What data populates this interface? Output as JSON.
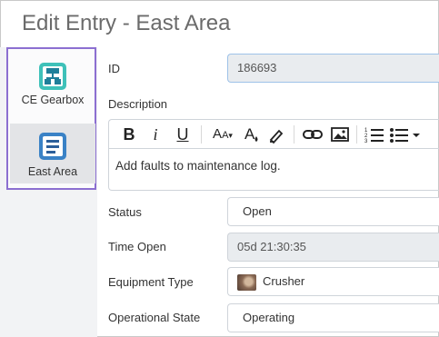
{
  "header": {
    "title": "Edit Entry - East Area"
  },
  "sidebar": {
    "items": [
      {
        "label": "CE Gearbox",
        "icon": "gearbox-hierarchy-icon",
        "active": false
      },
      {
        "label": "East Area",
        "icon": "area-document-icon",
        "active": true
      }
    ],
    "highlight_color": "#8c6fd1"
  },
  "form": {
    "id": {
      "label": "ID",
      "value": "186693"
    },
    "description": {
      "label": "Description",
      "content": "Add faults to maintenance log.",
      "toolbar": [
        "bold-icon",
        "italic-icon",
        "underline-icon",
        "font-size-icon",
        "text-color-icon",
        "highlight-icon",
        "link-icon",
        "image-icon",
        "ordered-list-icon",
        "unordered-list-icon"
      ]
    },
    "status": {
      "label": "Status",
      "value": "Open"
    },
    "time_open": {
      "label": "Time Open",
      "value": "05d 21:30:35"
    },
    "equipment_type": {
      "label": "Equipment Type",
      "value": "Crusher"
    },
    "operational_state": {
      "label": "Operational State",
      "value": "Operating"
    }
  }
}
